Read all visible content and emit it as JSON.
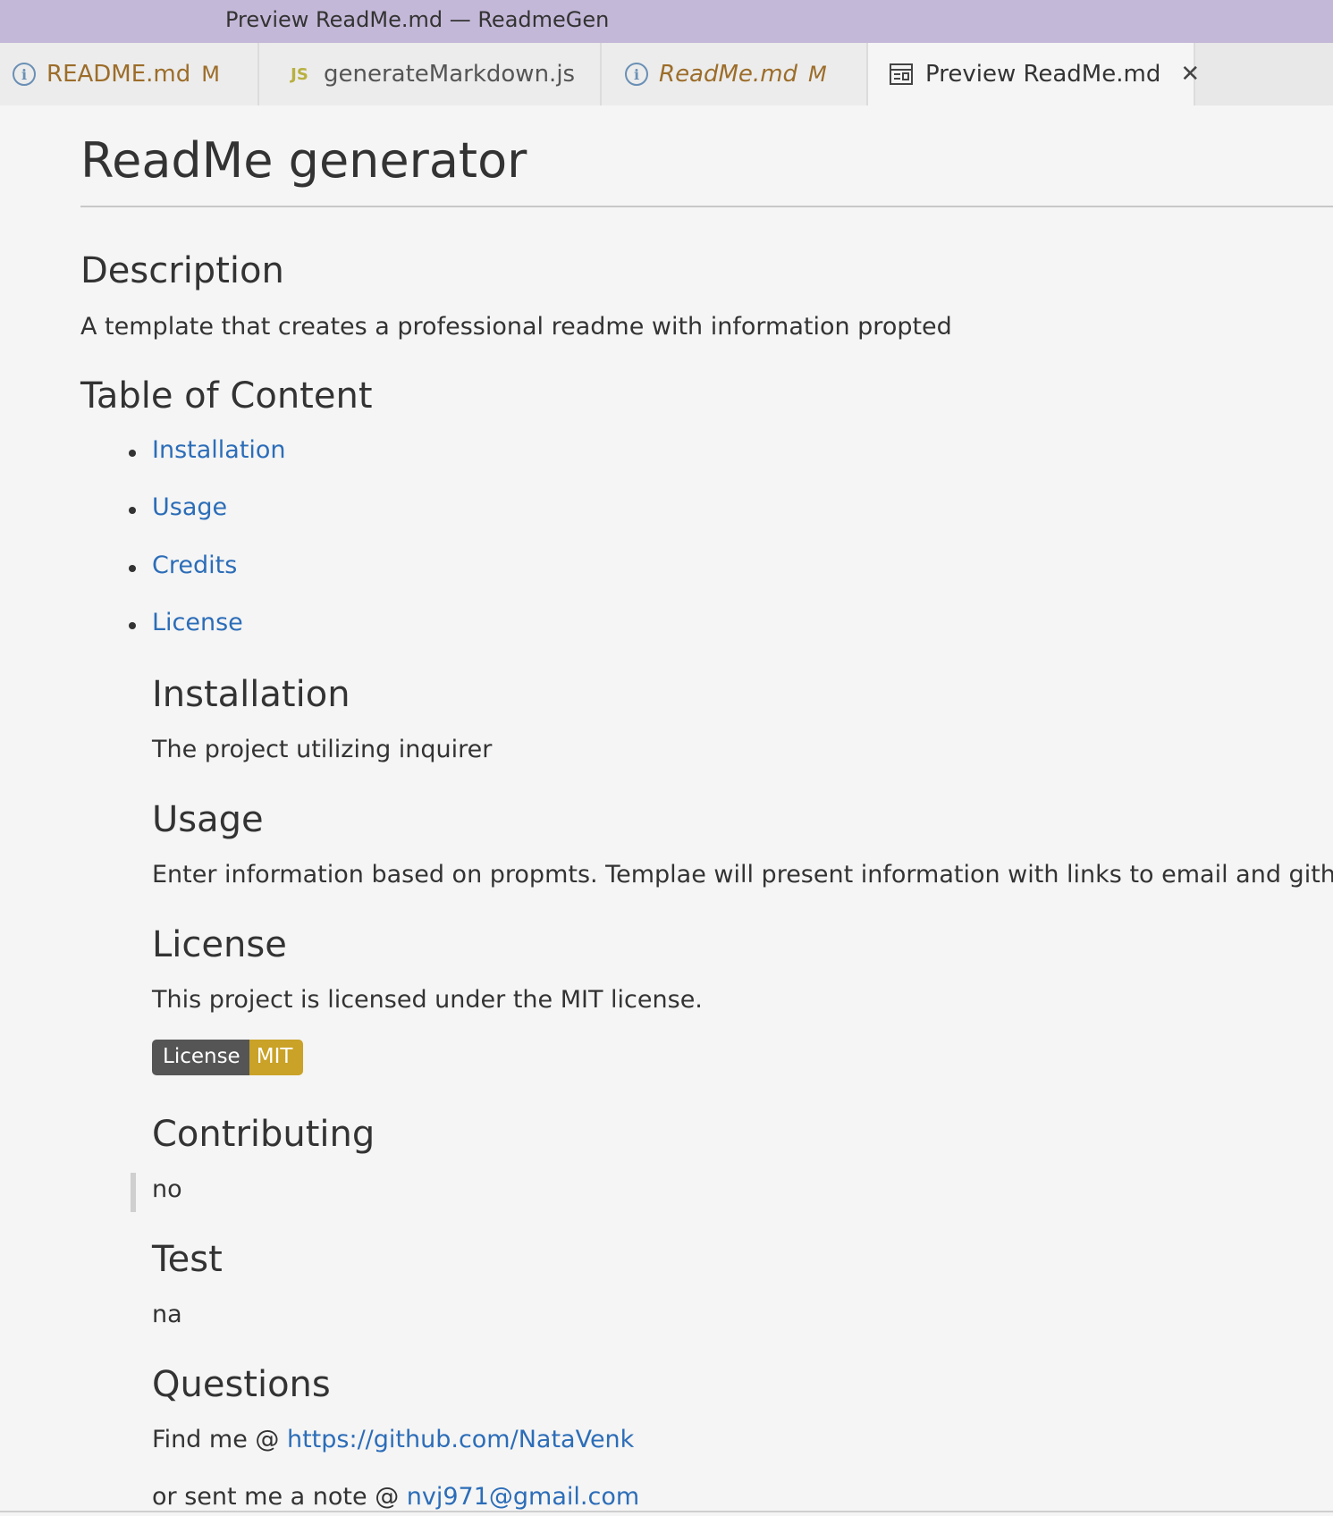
{
  "window": {
    "title": "Preview ReadMe.md — ReadmeGen"
  },
  "tabs": [
    {
      "label": "README.md",
      "icon": "info-icon",
      "modified": "M",
      "italic": false
    },
    {
      "label": "generateMarkdown.js",
      "icon": "js-icon",
      "icon_text": "JS"
    },
    {
      "label": "ReadMe.md",
      "icon": "info-icon",
      "modified": "M",
      "italic": true
    },
    {
      "label": "Preview ReadMe.md",
      "icon": "preview-icon",
      "active": true,
      "close": "✕"
    }
  ],
  "doc": {
    "title": "ReadMe generator",
    "description": {
      "heading": "Description",
      "text": "A template that creates a professional readme with information propted"
    },
    "toc": {
      "heading": "Table of Content",
      "items": [
        "Installation",
        "Usage",
        "Credits",
        "License"
      ]
    },
    "installation": {
      "heading": "Installation",
      "text": "The project utilizing inquirer"
    },
    "usage": {
      "heading": "Usage",
      "text": "Enter information based on propmts. Templae will present information with links to email and github."
    },
    "license": {
      "heading": "License",
      "text": "This project is licensed under the MIT license.",
      "badge_left": "License",
      "badge_right": "MIT"
    },
    "contributing": {
      "heading": "Contributing",
      "text": "no"
    },
    "test": {
      "heading": "Test",
      "text": "na"
    },
    "questions": {
      "heading": "Questions",
      "find_prefix": "Find me @ ",
      "github_link": "https://github.com/NataVenk",
      "note_prefix": "or sent me a note @ ",
      "email_link": "nvj971@gmail.com"
    }
  },
  "colors": {
    "titlebar": "#c4b8d8",
    "link": "#2c6db8",
    "modified": "#9c6d2a",
    "badge_left": "#555555",
    "badge_right": "#c9a227"
  }
}
